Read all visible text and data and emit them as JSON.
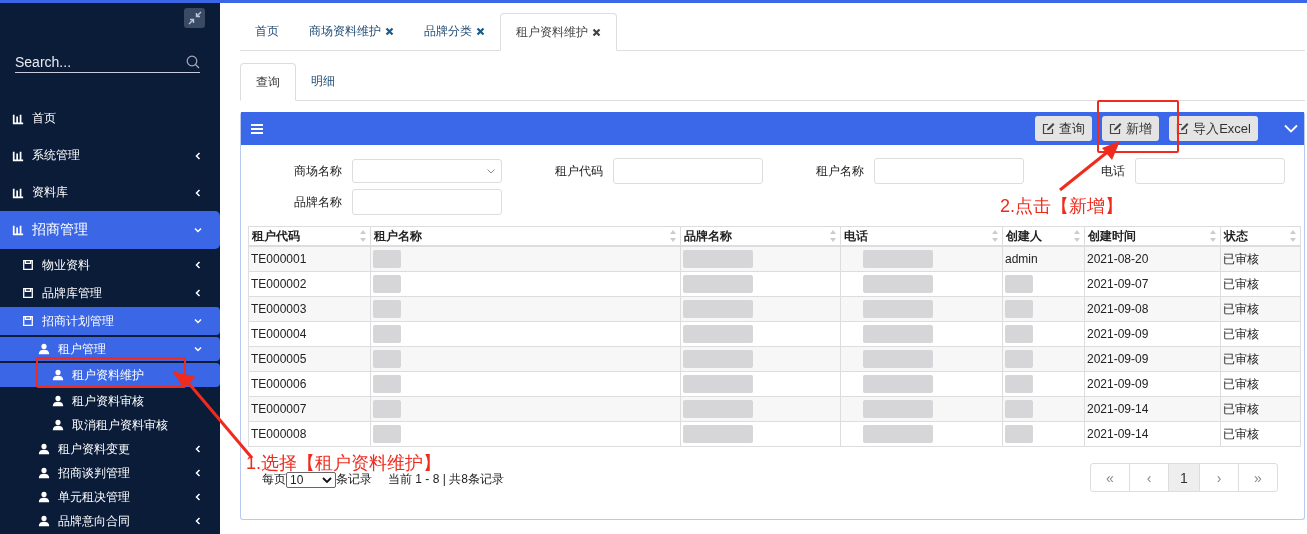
{
  "sidebar": {
    "search": {
      "placeholder": "Search..."
    },
    "items": [
      {
        "label": "首页",
        "selected": false
      },
      {
        "label": "系统管理",
        "selected": false,
        "expanded": false
      },
      {
        "label": "资料库",
        "selected": false,
        "expanded": false
      },
      {
        "label": "招商管理",
        "selected": true,
        "expanded": true,
        "children": [
          {
            "label": "物业资料",
            "selected": false,
            "expanded": false
          },
          {
            "label": "品牌库管理",
            "selected": false,
            "expanded": false
          },
          {
            "label": "招商计划管理",
            "selected": true,
            "expanded": true,
            "children": [
              {
                "label": "租户管理",
                "selected": true,
                "expanded": true,
                "children": [
                  {
                    "label": "租户资料维护",
                    "selected": true
                  },
                  {
                    "label": "租户资料审核",
                    "selected": false
                  },
                  {
                    "label": "取消租户资料审核",
                    "selected": false
                  }
                ]
              },
              {
                "label": "租户资料变更",
                "selected": false,
                "expanded": false
              },
              {
                "label": "招商谈判管理",
                "selected": false,
                "expanded": false
              },
              {
                "label": "单元租决管理",
                "selected": false,
                "expanded": false
              },
              {
                "label": "品牌意向合同",
                "selected": false,
                "expanded": false
              }
            ]
          }
        ]
      }
    ]
  },
  "tabs": [
    {
      "label": "首页",
      "closable": false,
      "selected": false
    },
    {
      "label": "商场资料维护",
      "closable": true,
      "selected": false
    },
    {
      "label": "品牌分类",
      "closable": true,
      "selected": false
    },
    {
      "label": "租户资料维护",
      "closable": true,
      "selected": true
    }
  ],
  "subtabs": [
    {
      "label": "查询",
      "selected": true
    },
    {
      "label": "明细",
      "selected": false
    }
  ],
  "toolbar": {
    "buttons": [
      "查询",
      "新增",
      "导入Excel"
    ]
  },
  "filters": [
    {
      "label": "商场名称",
      "kind": "select"
    },
    {
      "label": "租户代码",
      "kind": "text"
    },
    {
      "label": "租户名称",
      "kind": "text"
    },
    {
      "label": "电话",
      "kind": "text"
    },
    {
      "label": "品牌名称",
      "kind": "text"
    }
  ],
  "table": {
    "columns": [
      "租户代码",
      "租户名称",
      "品牌名称",
      "电话",
      "创建人",
      "创建时间",
      "状态"
    ],
    "rows": [
      {
        "code": "TE000001",
        "creator": "admin",
        "created": "2021-08-20",
        "status": "已审核"
      },
      {
        "code": "TE000002",
        "created": "2021-09-07",
        "status": "已审核"
      },
      {
        "code": "TE000003",
        "created": "2021-09-08",
        "status": "已审核"
      },
      {
        "code": "TE000004",
        "created": "2021-09-09",
        "status": "已审核"
      },
      {
        "code": "TE000005",
        "created": "2021-09-09",
        "status": "已审核"
      },
      {
        "code": "TE000006",
        "created": "2021-09-09",
        "status": "已审核"
      },
      {
        "code": "TE000007",
        "created": "2021-09-14",
        "status": "已审核"
      },
      {
        "code": "TE000008",
        "created": "2021-09-14",
        "status": "已审核"
      }
    ]
  },
  "footer": {
    "per_page_label": "每页",
    "per_page": "10",
    "records_label": "条记录",
    "summary": "当前 1 - 8 | 共8条记录"
  },
  "pagination": [
    {
      "label": "«",
      "selected": false
    },
    {
      "label": "‹",
      "selected": false
    },
    {
      "label": "1",
      "selected": true
    },
    {
      "label": "›",
      "selected": false
    },
    {
      "label": "»",
      "selected": false
    }
  ],
  "annotations": [
    {
      "text": "1.选择【租户资料维护】"
    },
    {
      "text": "2.点击【新增】"
    }
  ]
}
